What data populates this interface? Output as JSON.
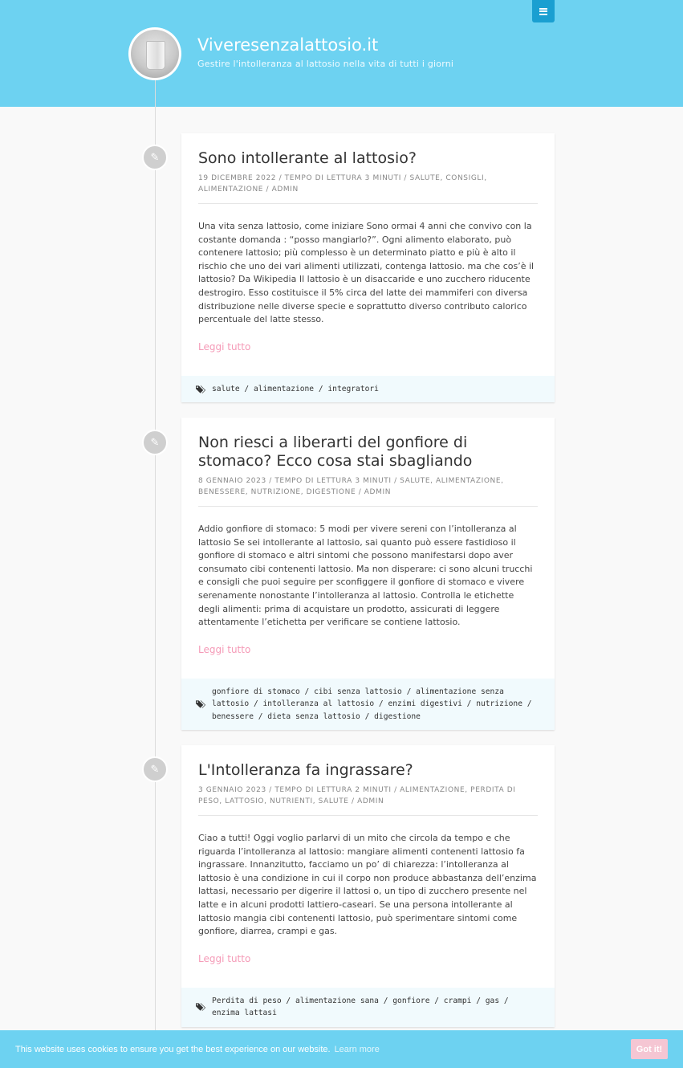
{
  "header": {
    "site_title": "Viveresenzalattosio.it",
    "site_description": "Gestire l'intolleranza al lattosio nella vita di tutti i giorni"
  },
  "posts": [
    {
      "title": "Sono intollerante al lattosio?",
      "meta": "19 dicembre 2022 / Tempo di lettura 3 minuti / Salute, Consigli, Alimentazione / admin",
      "excerpt": "Una vita senza lattosio, come iniziare Sono ormai 4 anni che convivo con la costante domanda : “posso mangiarlo?”. Ogni alimento elaborato, può contenere lattosio; più complesso è un determinato piatto e più è alto il rischio che uno dei vari alimenti utilizzati, contenga lattosio. ma che cos’è il lattosio? Da Wikipedia Il lattosio è un disaccaride e uno zucchero riducente destrogiro. Esso costituisce il 5% circa del latte dei mammiferi con diversa distribuzione nelle diverse specie e soprattutto diverso contributo calorico percentuale del latte stesso.",
      "read_more": "Leggi tutto",
      "tags": "salute / alimentazione / integratori"
    },
    {
      "title": "Non riesci a liberarti del gonfiore di stomaco? Ecco cosa stai sbagliando",
      "meta": "8 gennaio 2023 / Tempo di lettura 3 minuti / Salute, Alimentazione, Benessere, Nutrizione, Digestione / admin",
      "excerpt": "Addio gonfiore di stomaco: 5 modi per vivere sereni con l’intolleranza al lattosio Se sei intollerante al lattosio, sai quanto può essere fastidioso il gonfiore di stomaco e altri sintomi che possono manifestarsi dopo aver consumato cibi contenenti lattosio. Ma non disperare: ci sono alcuni trucchi e consigli che puoi seguire per sconfiggere il gonfiore di stomaco e vivere serenamente nonostante l’intolleranza al lattosio. Controlla le etichette degli alimenti: prima di acquistare un prodotto, assicurati di leggere attentamente l’etichetta per verificare se contiene lattosio.",
      "read_more": "Leggi tutto",
      "tags": "gonfiore di stomaco / cibi senza lattosio / alimentazione senza lattosio / intolleranza al lattosio / enzimi digestivi / nutrizione / benessere / dieta senza lattosio / digestione"
    },
    {
      "title": "L'Intolleranza fa ingrassare?",
      "meta": "3 gennaio 2023 / Tempo di lettura 2 minuti / Alimentazione, Perdita di peso, Lattosio, Nutrienti, Salute / admin",
      "excerpt": "Ciao a tutti! Oggi voglio parlarvi di un mito che circola da tempo e che riguarda l’intolleranza al lattosio: mangiare alimenti contenenti lattosio fa ingrassare. Innanzitutto, facciamo un po’ di chiarezza: l’intolleranza al lattosio è una condizione in cui il corpo non produce abbastanza dell’enzima lattasi, necessario per digerire il lattosi o, un tipo di zucchero presente nel latte e in alcuni prodotti lattiero-caseari. Se una persona intollerante al lattosio mangia cibi contenenti lattosio, può sperimentare sintomi come gonfiore, diarrea, crampi e gas.",
      "read_more": "Leggi tutto",
      "tags": "Perdita di peso / alimentazione sana / gonfiore / crampi / gas / enzima lattasi"
    }
  ],
  "cookie_bar": {
    "message": "This website uses cookies to ensure you get the best experience on our website.",
    "learn_more": "Learn more",
    "accept": "Got it!"
  },
  "icons": {
    "menu": "hamburger-icon",
    "post_format": "pencil-icon",
    "tags": "tags-icon"
  },
  "colors": {
    "header_bg": "#6dd2f1",
    "menu_button": "#1a9fd1",
    "read_more": "#f59ab7",
    "tags_bg": "#f1fafd",
    "cookie_button": "#f5c6d3"
  }
}
